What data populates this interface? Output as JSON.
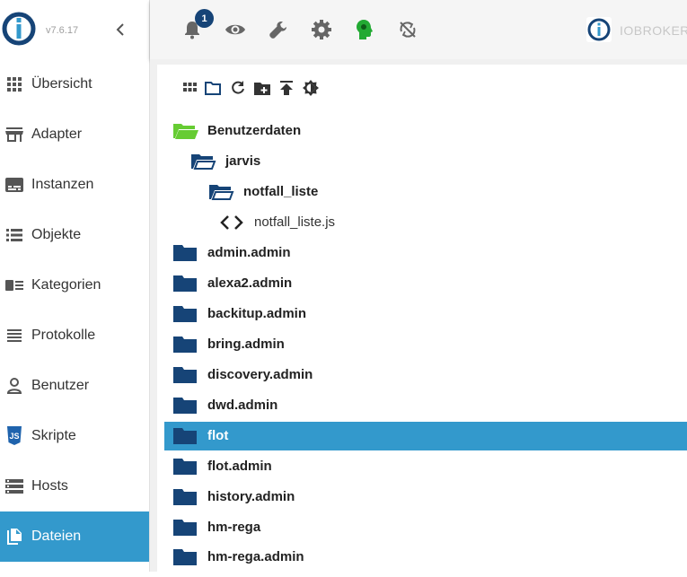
{
  "app": {
    "version": "v7.6.17"
  },
  "colors": {
    "accent": "#3399cc",
    "folder": "#164477",
    "open_folder": "#66cc33"
  },
  "sidebar": {
    "items": [
      {
        "label": "Übersicht",
        "icon": "apps-grid-icon"
      },
      {
        "label": "Adapter",
        "icon": "store-icon"
      },
      {
        "label": "Instanzen",
        "icon": "subtitles-icon"
      },
      {
        "label": "Objekte",
        "icon": "list-view-icon"
      },
      {
        "label": "Kategorien",
        "icon": "category-icon"
      },
      {
        "label": "Protokolle",
        "icon": "lines-icon"
      },
      {
        "label": "Benutzer",
        "icon": "person-icon"
      },
      {
        "label": "Skripte",
        "icon": "javascript-icon"
      },
      {
        "label": "Hosts",
        "icon": "storage-icon"
      },
      {
        "label": "Dateien",
        "icon": "file-copy-icon",
        "active": true
      }
    ]
  },
  "topbar": {
    "notifications_count": "1",
    "host_name": "IOBROKER"
  },
  "tree": [
    {
      "label": "Benutzerdaten",
      "type": "open-folder",
      "color": "green"
    },
    {
      "label": "jarvis",
      "type": "open-folder",
      "color": "blue"
    },
    {
      "label": "notfall_liste",
      "type": "open-folder",
      "color": "blue"
    },
    {
      "label": "notfall_liste.js",
      "type": "file"
    },
    {
      "label": "admin.admin",
      "type": "folder"
    },
    {
      "label": "alexa2.admin",
      "type": "folder"
    },
    {
      "label": "backitup.admin",
      "type": "folder"
    },
    {
      "label": "bring.admin",
      "type": "folder"
    },
    {
      "label": "discovery.admin",
      "type": "folder"
    },
    {
      "label": "dwd.admin",
      "type": "folder"
    },
    {
      "label": "flot",
      "type": "folder",
      "selected": true
    },
    {
      "label": "flot.admin",
      "type": "folder"
    },
    {
      "label": "history.admin",
      "type": "folder"
    },
    {
      "label": "hm-rega",
      "type": "folder"
    },
    {
      "label": "hm-rega.admin",
      "type": "folder"
    }
  ]
}
